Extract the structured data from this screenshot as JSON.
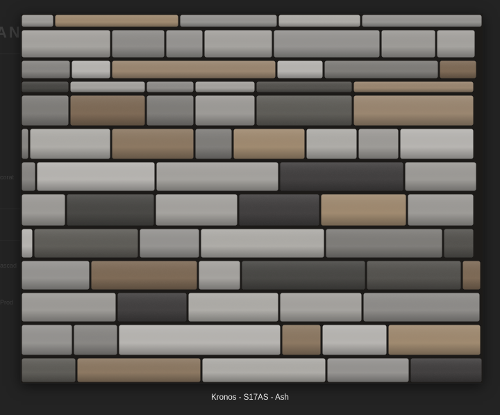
{
  "background_page": {
    "heading_fragment": "ANU",
    "side_fragments": [
      "corat",
      "ascad",
      "Prod"
    ]
  },
  "lightbox": {
    "image_alt": "Kronos - S17AS - Ash stone veneer swatch",
    "caption": "Kronos - S17AS - Ash"
  },
  "colors": {
    "page_background": "#262626",
    "caption_text": "#e8e8e8",
    "mortar": "#1c1a18"
  }
}
